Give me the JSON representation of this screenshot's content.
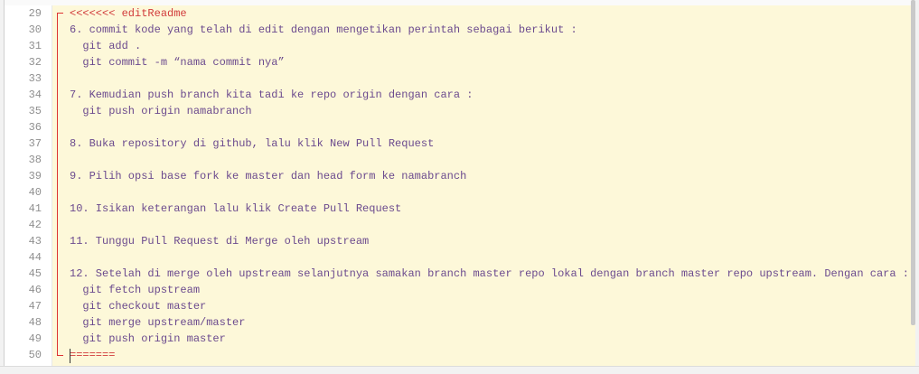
{
  "editor": {
    "lines": [
      {
        "num": "29",
        "text": "<<<<<<< editReadme",
        "kind": "marker"
      },
      {
        "num": "30",
        "text": "6. commit kode yang telah di edit dengan mengetikan perintah sebagai berikut :",
        "kind": "text"
      },
      {
        "num": "31",
        "text": "  git add .",
        "kind": "text"
      },
      {
        "num": "32",
        "text": "  git commit -m “nama commit nya”",
        "kind": "text"
      },
      {
        "num": "33",
        "text": "",
        "kind": "text"
      },
      {
        "num": "34",
        "text": "7. Kemudian push branch kita tadi ke repo origin dengan cara :",
        "kind": "text"
      },
      {
        "num": "35",
        "text": "  git push origin namabranch",
        "kind": "text"
      },
      {
        "num": "36",
        "text": "",
        "kind": "text"
      },
      {
        "num": "37",
        "text": "8. Buka repository di github, lalu klik New Pull Request",
        "kind": "text"
      },
      {
        "num": "38",
        "text": "",
        "kind": "text"
      },
      {
        "num": "39",
        "text": "9. Pilih opsi base fork ke master dan head form ke namabranch",
        "kind": "text"
      },
      {
        "num": "40",
        "text": "",
        "kind": "text"
      },
      {
        "num": "41",
        "text": "10. Isikan keterangan lalu klik Create Pull Request",
        "kind": "text"
      },
      {
        "num": "42",
        "text": "",
        "kind": "text"
      },
      {
        "num": "43",
        "text": "11. Tunggu Pull Request di Merge oleh upstream",
        "kind": "text"
      },
      {
        "num": "44",
        "text": "",
        "kind": "text"
      },
      {
        "num": "45",
        "text": "12. Setelah di merge oleh upstream selanjutnya samakan branch master repo lokal dengan branch master repo upstream. Dengan cara :",
        "kind": "text"
      },
      {
        "num": "46",
        "text": "  git fetch upstream",
        "kind": "text"
      },
      {
        "num": "47",
        "text": "  git checkout master",
        "kind": "text"
      },
      {
        "num": "48",
        "text": "  git merge upstream/master",
        "kind": "text"
      },
      {
        "num": "49",
        "text": "  git push origin master",
        "kind": "text"
      },
      {
        "num": "50",
        "text": "=======",
        "kind": "sep"
      }
    ]
  },
  "colors": {
    "conflict_bg": "#fdf8d9",
    "conflict_marker": "#d13b3b",
    "code_text": "#6b4a8e",
    "line_number": "#8f8f8f"
  }
}
